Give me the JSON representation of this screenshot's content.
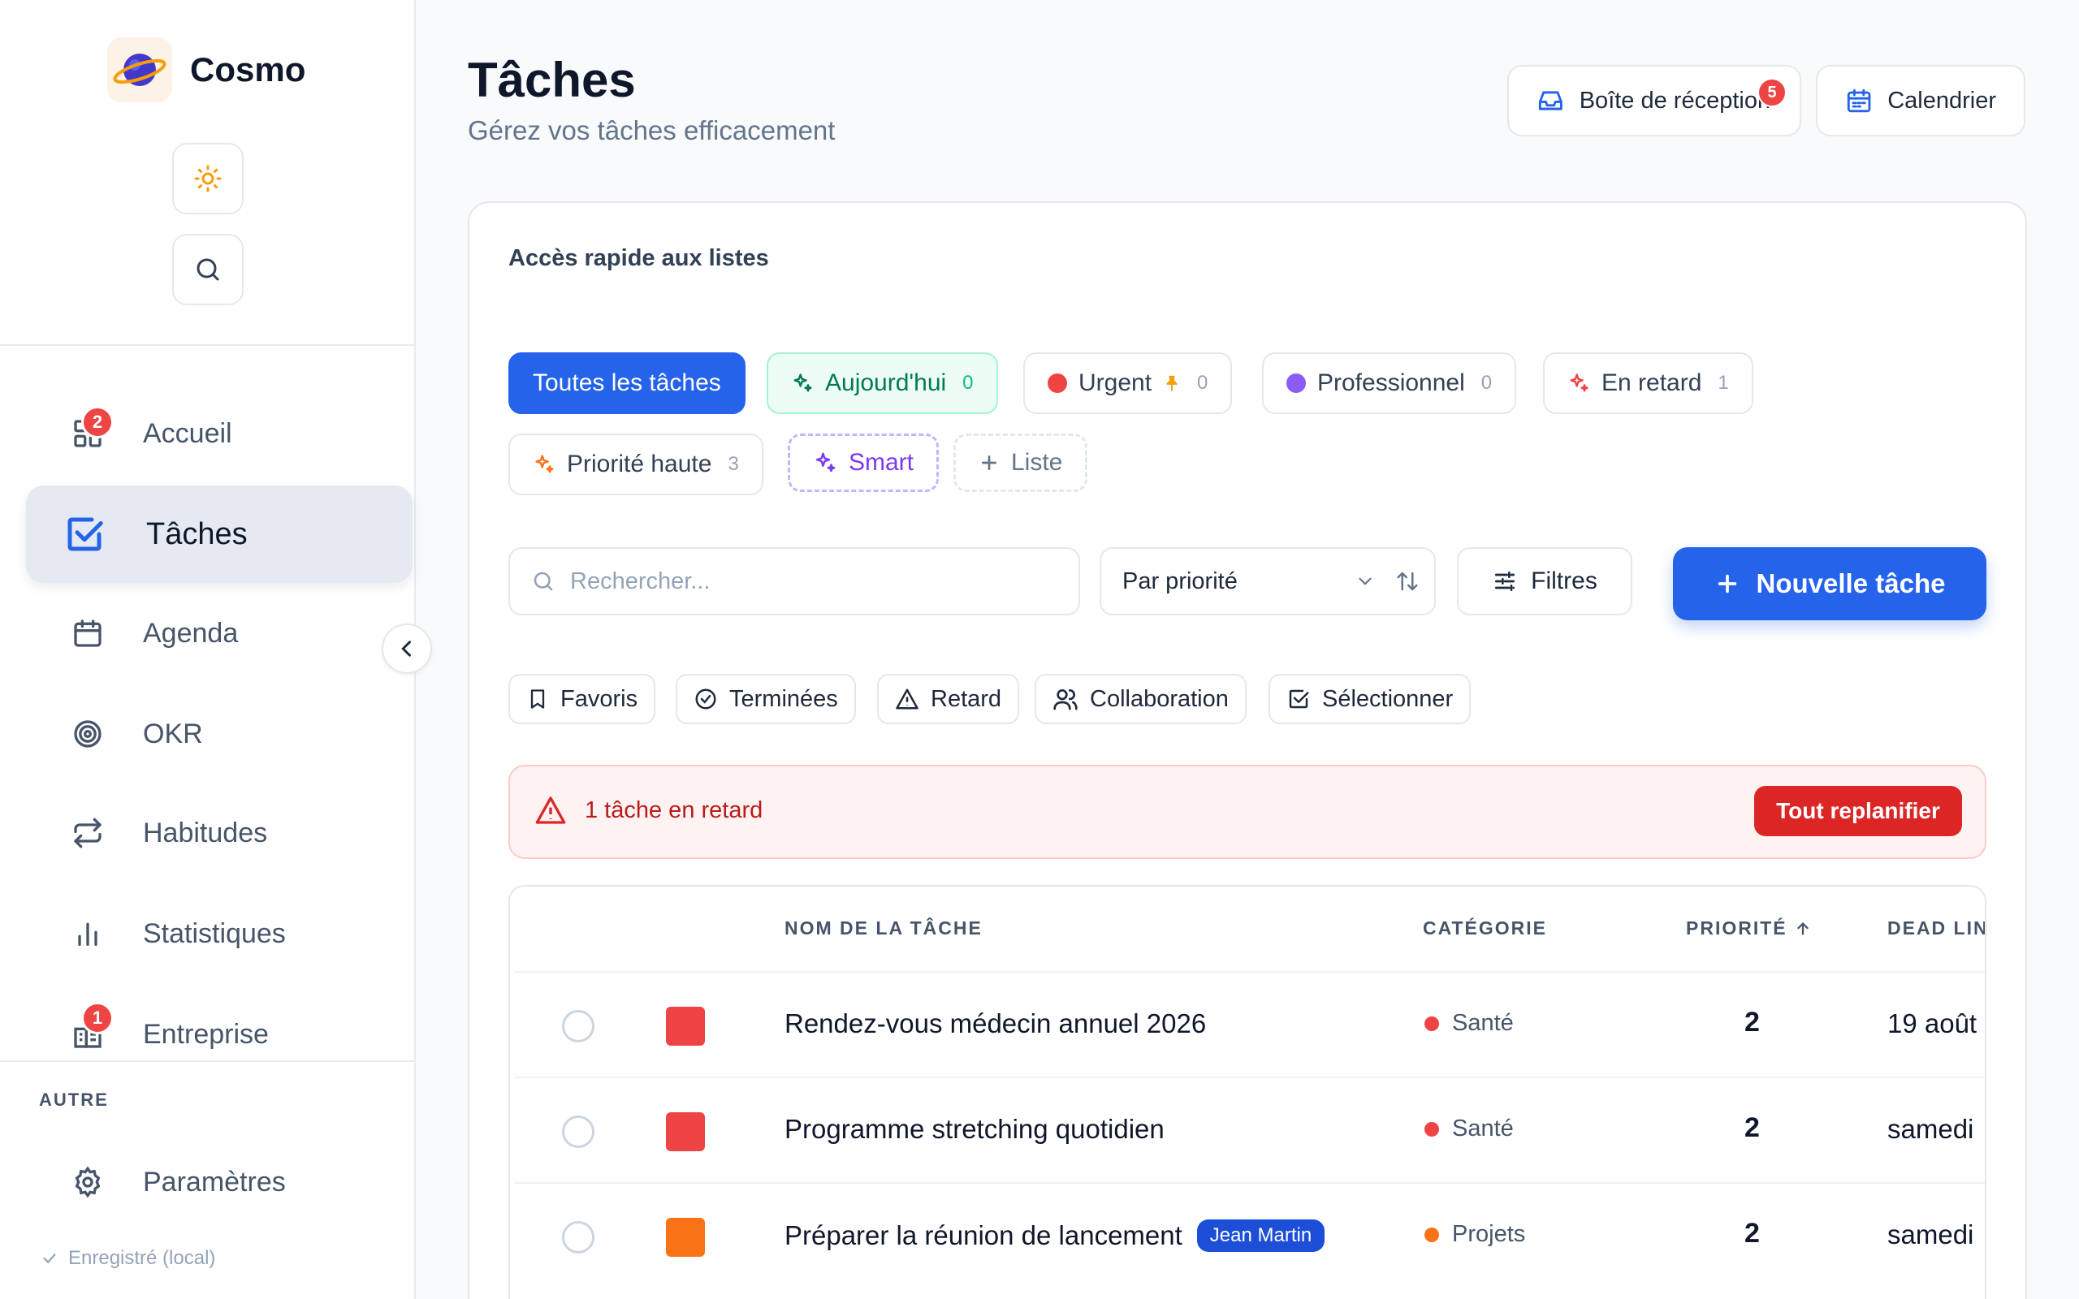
{
  "app": {
    "name": "Cosmo"
  },
  "sidebar": {
    "items": [
      {
        "label": "Accueil",
        "badge": "2",
        "icon": "dashboard-icon"
      },
      {
        "label": "Tâches",
        "icon": "checkbox-icon",
        "active": true
      },
      {
        "label": "Agenda",
        "icon": "calendar-icon"
      },
      {
        "label": "OKR",
        "icon": "target-icon"
      },
      {
        "label": "Habitudes",
        "icon": "repeat-icon"
      },
      {
        "label": "Statistiques",
        "icon": "bar-chart-icon"
      },
      {
        "label": "Entreprise",
        "badge": "1",
        "icon": "building-icon"
      }
    ],
    "section_other": "AUTRE",
    "settings_label": "Paramètres",
    "saved_status": "Enregistré (local)"
  },
  "header": {
    "title": "Tâches",
    "subtitle": "Gérez vos tâches efficacement",
    "inbox_label": "Boîte de réception",
    "inbox_badge": "5",
    "calendar_label": "Calendrier"
  },
  "quick_lists": {
    "title": "Accès rapide aux listes",
    "chips": [
      {
        "label": "Toutes les tâches"
      },
      {
        "label": "Aujourd'hui",
        "count": "0"
      },
      {
        "label": "Urgent",
        "count": "0"
      },
      {
        "label": "Professionnel",
        "count": "0"
      },
      {
        "label": "En retard",
        "count": "1"
      },
      {
        "label": "Priorité haute",
        "count": "3"
      },
      {
        "label": "Smart"
      },
      {
        "label": "Liste"
      }
    ]
  },
  "toolbar": {
    "search_placeholder": "Rechercher...",
    "sort_value": "Par priorité",
    "filters_label": "Filtres",
    "new_task_label": "Nouvelle tâche"
  },
  "filter_chips": [
    "Favoris",
    "Terminées",
    "Retard",
    "Collaboration",
    "Sélectionner"
  ],
  "alert": {
    "text": "1 tâche en retard",
    "button": "Tout replanifier"
  },
  "table": {
    "headers": {
      "name": "NOM DE LA TÂCHE",
      "category": "CATÉGORIE",
      "priority": "PRIORITÉ",
      "deadline": "DEAD LINE"
    },
    "rows": [
      {
        "name": "Rendez-vous médecin annuel 2026",
        "category": "Santé",
        "priority": "2",
        "deadline": "19 août",
        "color": "#ef4444",
        "cat_color": "#ef4444"
      },
      {
        "name": "Programme stretching quotidien",
        "category": "Santé",
        "priority": "2",
        "deadline": "samedi",
        "color": "#ef4444",
        "cat_color": "#ef4444"
      },
      {
        "name": "Préparer la réunion de lancement",
        "assignee": "Jean Martin",
        "category": "Projets",
        "priority": "2",
        "deadline": "samedi",
        "color": "#f97316",
        "cat_color": "#f97316"
      }
    ]
  },
  "colors": {
    "accent": "#2563eb",
    "danger": "#dc2626",
    "success": "#047857",
    "purple": "#7c3aed"
  }
}
